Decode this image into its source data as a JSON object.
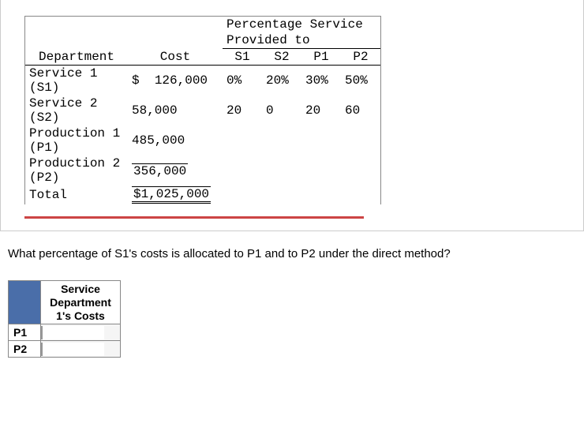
{
  "table": {
    "spanningHeader1": "Percentage Service",
    "spanningHeader2": "Provided to",
    "cols": {
      "dept": "Department",
      "cost": "Cost",
      "s1": "S1",
      "s2": "S2",
      "p1": "P1",
      "p2": "P2"
    },
    "rows": [
      {
        "dept": "Service 1 (S1)",
        "currency": "$",
        "cost": "126,000",
        "s1": "0%",
        "s2": "20%",
        "p1": "30%",
        "p2": "50%"
      },
      {
        "dept": "Service 2 (S2)",
        "currency": "",
        "cost": "58,000",
        "s1": "20",
        "s2": "0",
        "p1": "20",
        "p2": "60"
      },
      {
        "dept": "Production 1 (P1)",
        "currency": "",
        "cost": "485,000",
        "s1": "",
        "s2": "",
        "p1": "",
        "p2": ""
      },
      {
        "dept": "Production 2 (P2)",
        "currency": "",
        "cost": "356,000",
        "s1": "",
        "s2": "",
        "p1": "",
        "p2": ""
      }
    ],
    "total": {
      "label": "Total",
      "value": "$1,025,000"
    }
  },
  "question": "What percentage of S1's costs is allocated to P1 and to P2 under the direct method?",
  "answerTable": {
    "header": "Service Department 1's Costs",
    "rows": [
      "P1",
      "P2"
    ]
  },
  "chart_data": {
    "type": "table",
    "title": "Percentage Service Provided to",
    "columns": [
      "Department",
      "Cost",
      "S1",
      "S2",
      "P1",
      "P2"
    ],
    "rows": [
      [
        "Service 1 (S1)",
        126000,
        0,
        20,
        30,
        50
      ],
      [
        "Service 2 (S2)",
        58000,
        20,
        0,
        20,
        60
      ],
      [
        "Production 1 (P1)",
        485000,
        null,
        null,
        null,
        null
      ],
      [
        "Production 2 (P2)",
        356000,
        null,
        null,
        null,
        null
      ],
      [
        "Total",
        1025000,
        null,
        null,
        null,
        null
      ]
    ]
  }
}
